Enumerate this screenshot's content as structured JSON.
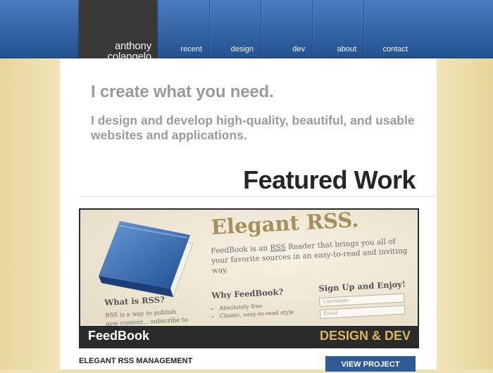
{
  "header": {
    "logo": {
      "line1": "anthony",
      "line2": "colangelo"
    },
    "nav": [
      {
        "label": "recent"
      },
      {
        "label": "design"
      },
      {
        "label": "dev"
      },
      {
        "label": "about"
      },
      {
        "label": "contact"
      }
    ]
  },
  "hero": {
    "headline": "I create what you need.",
    "subheadline": "I design and develop high-quality, beautiful, and usable websites and applications."
  },
  "featured": {
    "section_title": "Featured Work",
    "project": {
      "screenshot": {
        "title": "Elegant RSS.",
        "description_prefix": "FeedBook is an ",
        "description_link": "RSS",
        "description_suffix": " Reader that brings you all of your favorite sources in an easy-to-read and inviting way.",
        "col1_heading": "What is RSS?",
        "col1_text": "RSS is a way to publish new content... subscribe to",
        "col2_heading": "Why FeedBook?",
        "col2_items": [
          "Absolutely free",
          "Classic, easy-to-read style"
        ],
        "col3_heading": "Sign Up and Enjoy!",
        "col3_username_placeholder": "Username",
        "col3_email_placeholder": "Email"
      },
      "name": "FeedBook",
      "tags": "DESIGN & DEV",
      "subtitle": "ELEGANT RSS MANAGEMENT",
      "cta_label": "VIEW PROJECT"
    }
  },
  "colors": {
    "header_blue": "#2e5e9e",
    "logo_bg": "#3a3836",
    "page_bg": "#efe2b2",
    "accent_gold": "#d9b661",
    "button_blue": "#2f5c96"
  }
}
